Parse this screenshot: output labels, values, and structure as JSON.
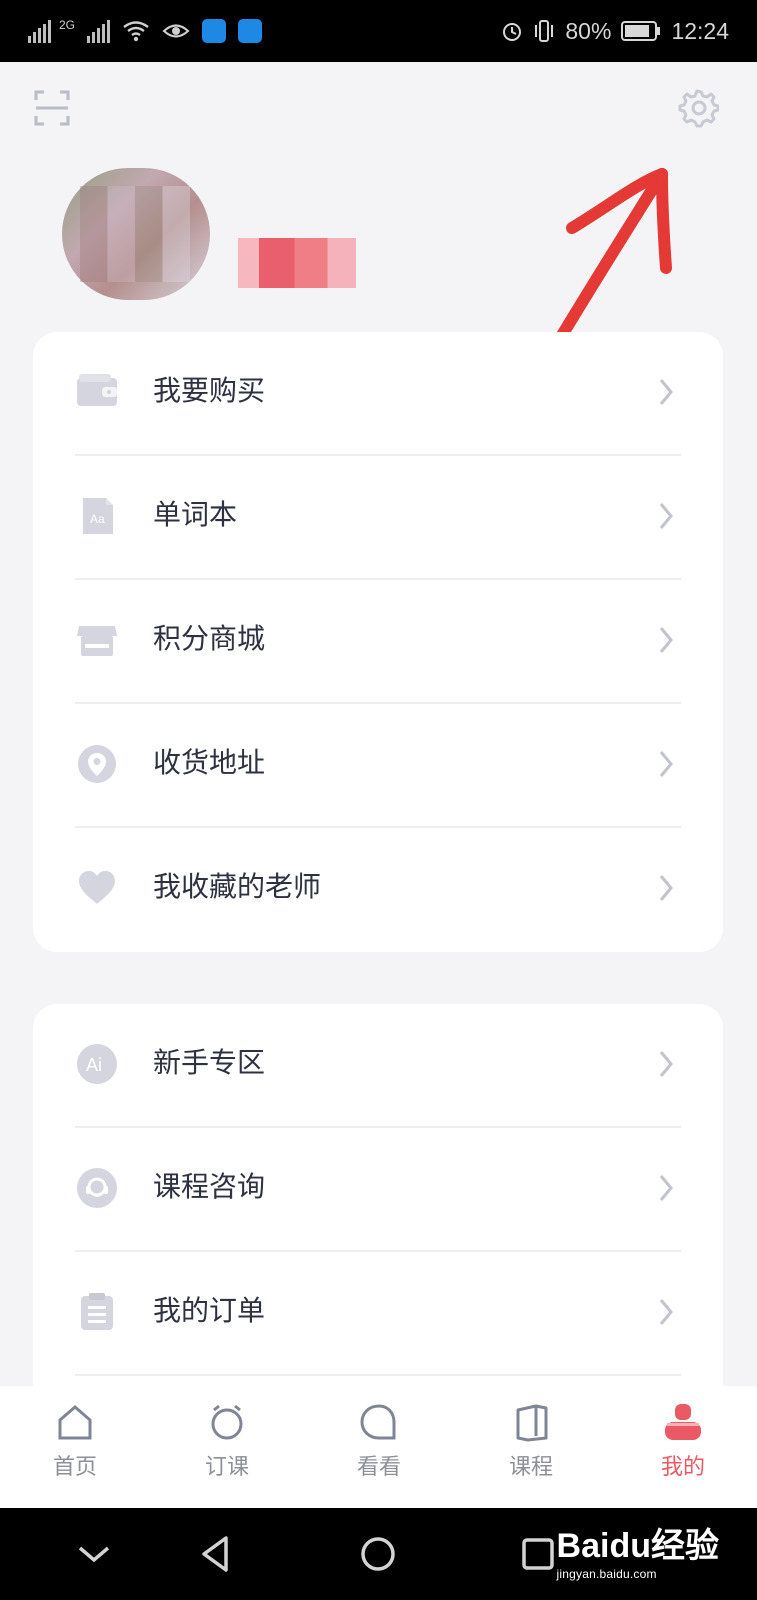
{
  "status": {
    "left_mini_text": "2G",
    "battery": "80%",
    "time": "12:24"
  },
  "header": {
    "icons": [
      "scan-icon",
      "gear-icon"
    ]
  },
  "profile": {
    "name_redacted": true
  },
  "sections": {
    "primary": [
      {
        "label": "我要购买",
        "icon": "wallet-icon"
      },
      {
        "label": "单词本",
        "icon": "wordbook-icon"
      },
      {
        "label": "积分商城",
        "icon": "shop-icon"
      },
      {
        "label": "收货地址",
        "icon": "location-icon"
      },
      {
        "label": "我收藏的老师",
        "icon": "heart-icon"
      }
    ],
    "secondary": [
      {
        "label": "新手专区",
        "icon": "ai-icon"
      },
      {
        "label": "课程咨询",
        "icon": "support-icon"
      },
      {
        "label": "我的订单",
        "icon": "clipboard-icon"
      }
    ]
  },
  "bottom_nav": [
    {
      "label": "首页",
      "icon": "home-icon",
      "active": false
    },
    {
      "label": "订课",
      "icon": "alarm-icon",
      "active": false
    },
    {
      "label": "看看",
      "icon": "chat-bubble-icon",
      "active": false
    },
    {
      "label": "课程",
      "icon": "book-icon",
      "active": false
    },
    {
      "label": "我的",
      "icon": "profile-icon",
      "active": true
    }
  ],
  "watermark": {
    "main": "Baidu经验",
    "site": "jingyan.baidu.com"
  },
  "colors": {
    "accent": "#ea5a64",
    "icon_gray": "#d4d5de",
    "page_bg": "#f4f4f7",
    "card_bg": "#ffffff"
  }
}
